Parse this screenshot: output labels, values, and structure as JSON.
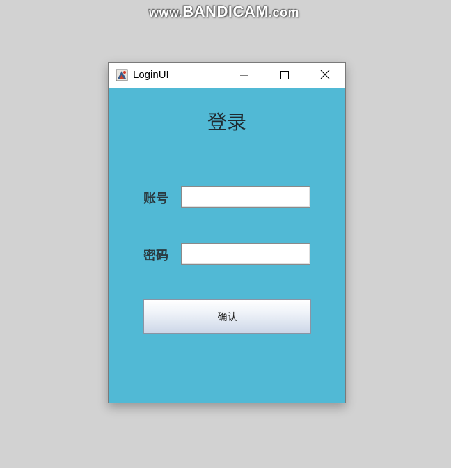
{
  "watermark": {
    "prefix": "www.",
    "brand": "BANDICAM",
    "suffix": ".com"
  },
  "window": {
    "title": "LoginUI",
    "controls": {
      "minimize_icon": "minimize-icon",
      "maximize_icon": "maximize-icon",
      "close_icon": "close-icon"
    },
    "background_color": "#51b9d5"
  },
  "form": {
    "heading": "登录",
    "account": {
      "label": "账号",
      "value": "",
      "placeholder": ""
    },
    "password": {
      "label": "密码",
      "value": "",
      "placeholder": ""
    },
    "confirm_label": "确认"
  }
}
